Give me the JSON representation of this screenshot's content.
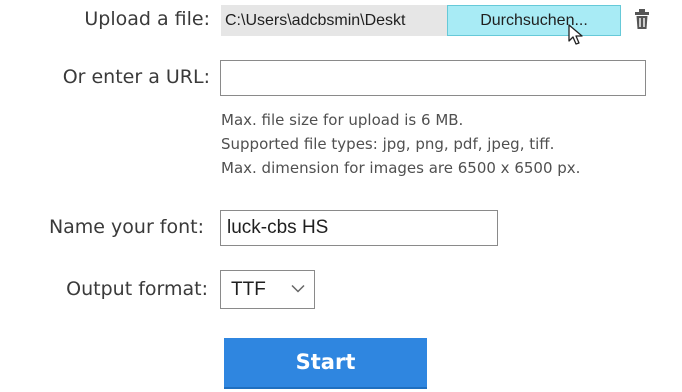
{
  "upload": {
    "label": "Upload a file:",
    "file_path": "C:\\Users\\adcbsmin\\Deskt",
    "browse_label": "Durchsuchen..."
  },
  "url": {
    "label": "Or enter a URL:",
    "value": ""
  },
  "help": {
    "line1": "Max. file size for upload is 6 MB.",
    "line2": "Supported file types: jpg, png, pdf, jpeg, tiff.",
    "line3": "Max. dimension for images are 6500 x 6500 px."
  },
  "font_name": {
    "label": "Name your font:",
    "value": "luck-cbs HS"
  },
  "output_format": {
    "label": "Output format:",
    "selected": "TTF"
  },
  "start_label": "Start",
  "icons": {
    "trash": "trash-icon",
    "cursor": "mouse-cursor-icon",
    "dropdown": "chevron-down-icon"
  },
  "colors": {
    "browse_bg": "#a8ebf5",
    "start_bg": "#2f86e0",
    "path_bg": "#e6e6e6"
  }
}
